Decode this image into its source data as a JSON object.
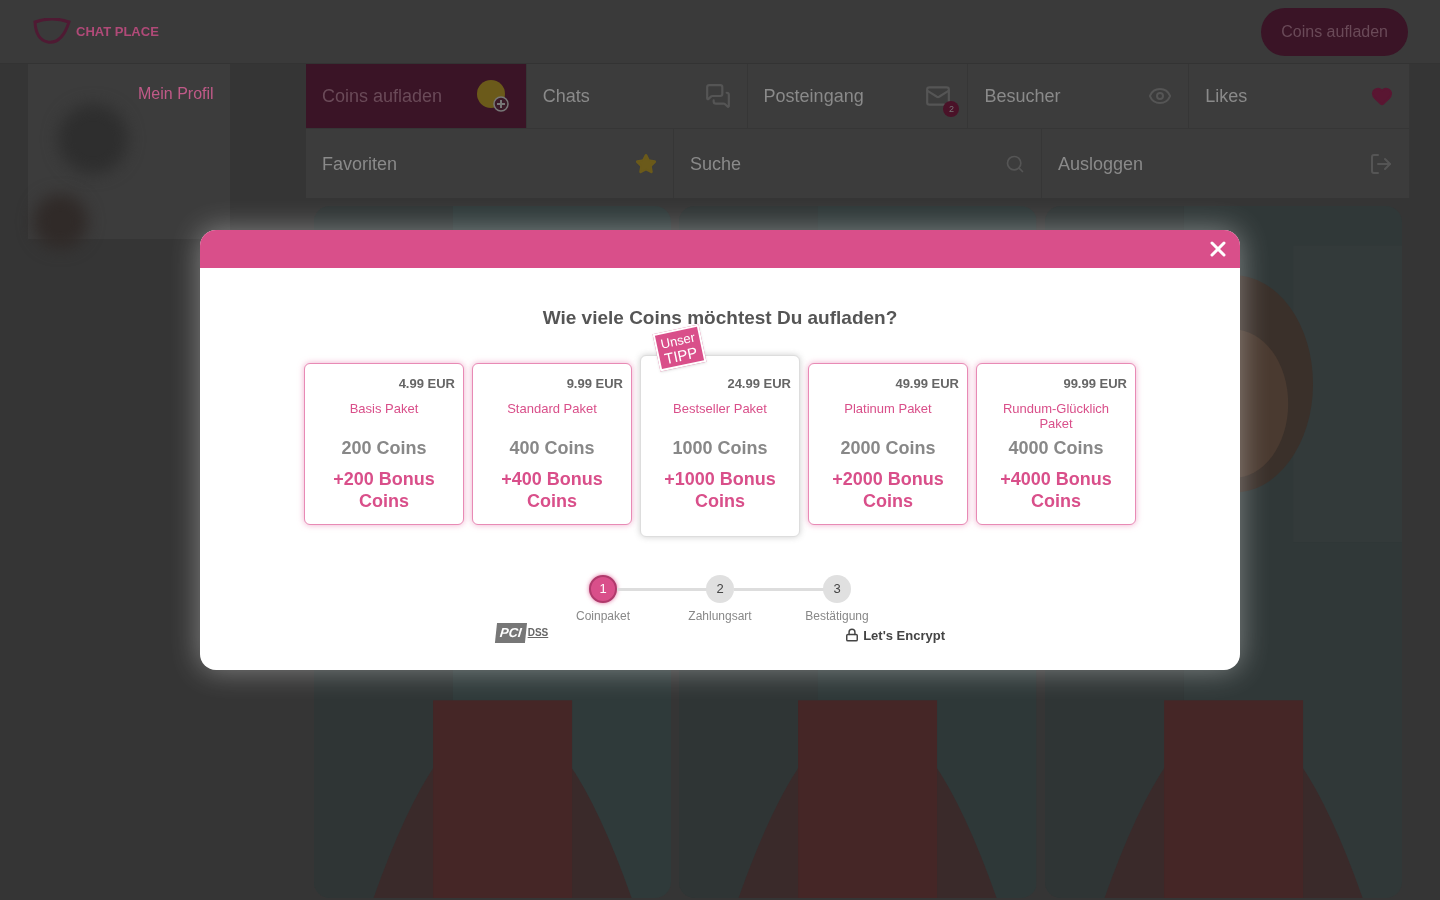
{
  "header": {
    "logo_text": "CHAT PLACE",
    "button": "Coins aufladen"
  },
  "profile": {
    "link": "Mein Profil"
  },
  "nav_tabs": [
    {
      "label": "Coins aufladen",
      "kind": "coin",
      "selected": true
    },
    {
      "label": "Chats",
      "kind": "chats",
      "selected": false
    },
    {
      "label": "Posteingang",
      "kind": "mail",
      "badge": "2",
      "selected": false
    },
    {
      "label": "Besucher",
      "kind": "eye",
      "selected": false
    },
    {
      "label": "Likes",
      "kind": "heart",
      "selected": false
    }
  ],
  "nav_links": [
    {
      "label": "Favoriten",
      "kind": "star"
    },
    {
      "label": "Suche",
      "kind": "search"
    },
    {
      "label": "Ausloggen",
      "kind": "logout"
    }
  ],
  "modal": {
    "title": "Wie viele Coins möchtest Du aufladen?",
    "tip_badge": [
      "Unser",
      "TIPP"
    ],
    "packages": [
      {
        "price": "4.99 EUR",
        "name": "Basis Paket",
        "coins": "200 Coins",
        "bonus": "+200 Bonus Coins",
        "featured": false
      },
      {
        "price": "9.99 EUR",
        "name": "Standard Paket",
        "coins": "400 Coins",
        "bonus": "+400 Bonus Coins",
        "featured": false
      },
      {
        "price": "24.99 EUR",
        "name": "Bestseller Paket",
        "coins": "1000 Coins",
        "bonus": "+1000 Bonus Coins",
        "featured": true
      },
      {
        "price": "49.99 EUR",
        "name": "Platinum Paket",
        "coins": "2000 Coins",
        "bonus": "+2000 Bonus Coins",
        "featured": false
      },
      {
        "price": "99.99 EUR",
        "name": "Rundum-Glücklich Paket",
        "coins": "4000 Coins",
        "bonus": "+4000 Bonus Coins",
        "featured": false
      }
    ],
    "steps": [
      {
        "number": "1",
        "label": "Coinpaket",
        "selected": true
      },
      {
        "number": "2",
        "label": "Zahlungsart",
        "selected": false
      },
      {
        "number": "3",
        "label": "Bestätigung",
        "selected": false
      }
    ],
    "trust": {
      "pci": "PCI",
      "dss": "DSS",
      "encrypt": "Let's Encrypt"
    }
  }
}
